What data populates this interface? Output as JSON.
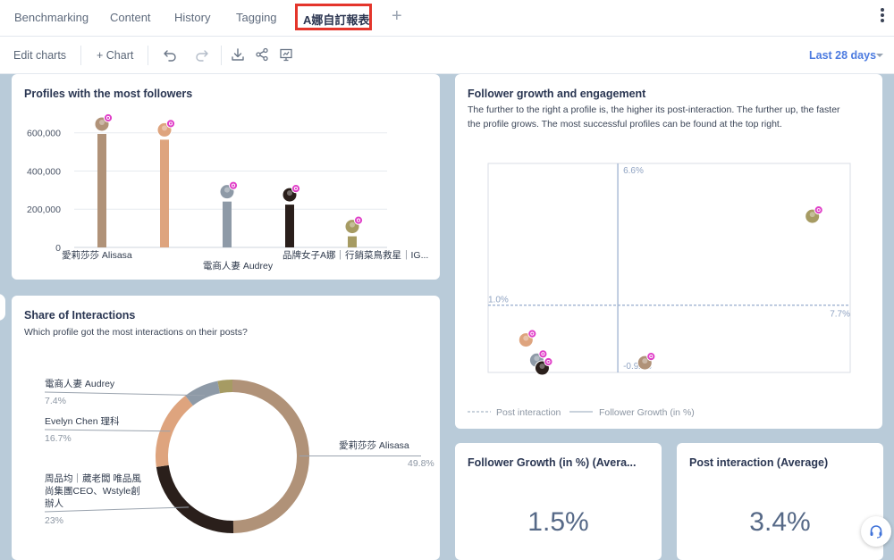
{
  "tabs": [
    {
      "label": "Benchmarking",
      "active": false
    },
    {
      "label": "Content",
      "active": false
    },
    {
      "label": "History",
      "active": false
    },
    {
      "label": "Tagging",
      "active": false
    },
    {
      "label": "A娜自訂報表",
      "active": true
    }
  ],
  "toolbar": {
    "edit_charts": "Edit charts",
    "add_chart": "+ Chart",
    "date_range": "Last 28 days",
    "icons": [
      "undo-icon",
      "redo-icon",
      "download-icon",
      "share-icon",
      "present-icon"
    ]
  },
  "followers_card": {
    "title": "Profiles with the most followers",
    "chart_data": {
      "type": "bar",
      "categories": [
        "愛莉莎莎 Alisasa",
        "Evelyn Chen 理科",
        "電商人妻 Audrey",
        "周品均｜葳老闆 唯品風尚集團CEO、Wstyle創辦人",
        "品牌女子A娜｜行銷菜鳥救星｜IG..."
      ],
      "tick_labels": [
        "愛莉莎莎 Alisasa",
        "電商人妻 Audrey",
        "品牌女子A娜｜行銷菜鳥救星｜IG..."
      ],
      "values": [
        594000,
        564000,
        240000,
        224000,
        58000
      ],
      "colors": [
        "#b09278",
        "#dea47e",
        "#8e9aa7",
        "#2a1f1b",
        "#a69b63"
      ],
      "y_ticks": [
        "0",
        "200,000",
        "400,000",
        "600,000"
      ],
      "ylim": [
        0,
        650000
      ],
      "grid": true
    }
  },
  "interactions_card": {
    "title": "Share of Interactions",
    "subtitle": "Which profile got the most interactions on their posts?",
    "chart_data": {
      "type": "pie",
      "slices": [
        {
          "name": "愛莉莎莎 Alisasa",
          "label": "愛莉莎莎 Alisasa",
          "label_lines": [
            "愛莉莎莎 Alisasa"
          ],
          "value": 49.8,
          "pct": "49.8%",
          "color": "#b09278"
        },
        {
          "name": "周品均",
          "label": "周品均｜葳老闆 唯品風尚集團CEO、Wstyle創辦人",
          "label_lines": [
            "周品均｜葳老闆 唯品風",
            "尚集團CEO、Wstyle創",
            "辦人"
          ],
          "value": 23,
          "pct": "23%",
          "color": "#2a1f1b"
        },
        {
          "name": "Evelyn Chen 理科",
          "label": "Evelyn Chen 理科",
          "label_lines": [
            "Evelyn Chen 理科"
          ],
          "value": 16.7,
          "pct": "16.7%",
          "color": "#dea47e"
        },
        {
          "name": "電商人妻 Audrey",
          "label": "電商人妻 Audrey",
          "label_lines": [
            "電商人妻 Audrey"
          ],
          "value": 7.4,
          "pct": "7.4%",
          "color": "#8e9aa7"
        },
        {
          "name": "品牌女子A娜",
          "label": "",
          "label_lines": [],
          "value": 3.1,
          "pct": "",
          "color": "#a69b63"
        }
      ]
    }
  },
  "growth_card": {
    "title": "Follower growth and engagement",
    "subtitle_lines": [
      "The further to the right a profile is, the higher its post-interaction. The further up, the faster",
      "the profile grows. The most successful profiles can be found at the top right."
    ],
    "legend": {
      "post_interaction": "Post interaction",
      "follower_growth": "Follower Growth (in %)"
    },
    "chart_data": {
      "type": "scatter",
      "x_label": "Post interaction",
      "y_label": "Follower Growth (in %)",
      "xlim": [
        1.0,
        7.7
      ],
      "ylim": [
        -0.92,
        6.6
      ],
      "labels": {
        "x_min": "1.0%",
        "x_max": "7.7%",
        "y_max": "6.6%",
        "y_min": "-0.92%"
      },
      "average_x": 3.4,
      "average_y": 1.5,
      "points": [
        {
          "name": "品牌女子A娜",
          "x": 7.0,
          "y": 4.7,
          "color": "#a69b63"
        },
        {
          "name": "Evelyn Chen 理科",
          "x": 1.7,
          "y": 0.25,
          "color": "#dea47e"
        },
        {
          "name": "電商人妻 Audrey",
          "x": 1.9,
          "y": -0.48,
          "color": "#8e9aa7"
        },
        {
          "name": "周品均",
          "x": 2.0,
          "y": -0.76,
          "color": "#2a1f1b"
        },
        {
          "name": "愛莉莎莎 Alisasa",
          "x": 3.9,
          "y": -0.57,
          "color": "#b09278"
        }
      ]
    }
  },
  "kpi_growth": {
    "title": "Follower Growth (in %) (Avera...",
    "value": "1.5%"
  },
  "kpi_interaction": {
    "title": "Post interaction (Average)",
    "value": "3.4%"
  },
  "support": {
    "icon": "headset-icon"
  }
}
